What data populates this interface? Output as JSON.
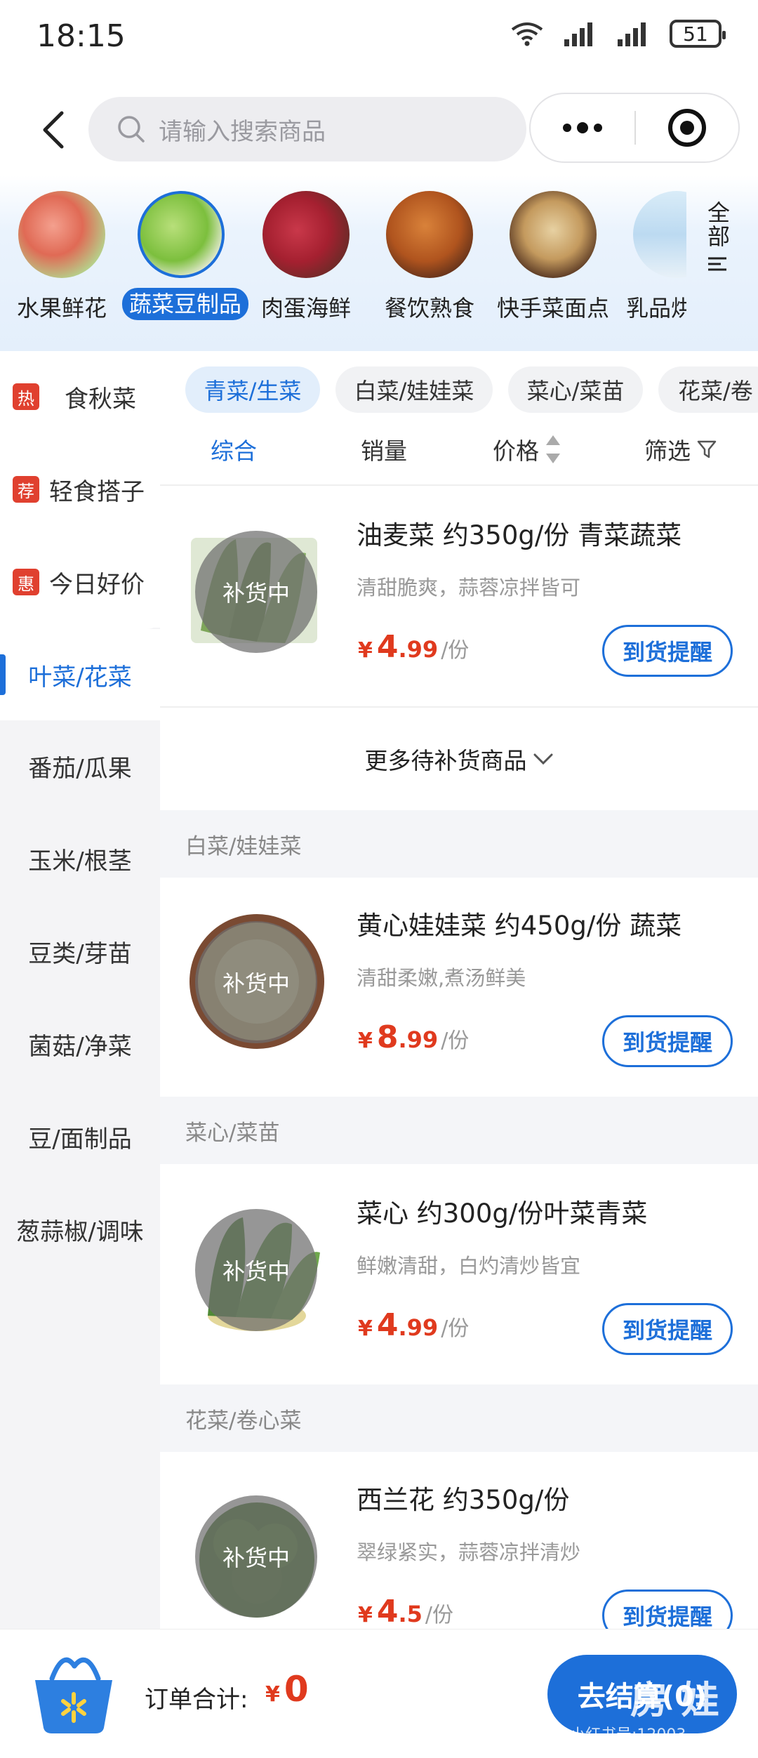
{
  "status_bar": {
    "time": "18:15",
    "battery": "51"
  },
  "header": {
    "search_placeholder": "请输入搜索商品"
  },
  "categories": [
    {
      "label": "水果鲜花",
      "active": false
    },
    {
      "label": "蔬菜豆制品",
      "active": true
    },
    {
      "label": "肉蛋海鲜",
      "active": false
    },
    {
      "label": "餐饮熟食",
      "active": false
    },
    {
      "label": "快手菜面点",
      "active": false
    },
    {
      "label": "乳品烘",
      "active": false
    }
  ],
  "category_all": "全部",
  "sidebar": {
    "items": [
      {
        "badge": "热",
        "label": "食秋菜"
      },
      {
        "badge": "荐",
        "label": "轻食搭子"
      },
      {
        "badge": "惠",
        "label": "今日好价"
      },
      {
        "label": "叶菜/花菜",
        "active": true
      },
      {
        "label": "番茄/瓜果"
      },
      {
        "label": "玉米/根茎"
      },
      {
        "label": "豆类/芽苗"
      },
      {
        "label": "菌菇/净菜"
      },
      {
        "label": "豆/面制品"
      },
      {
        "label": "葱蒜椒/调味"
      }
    ]
  },
  "subcategories": [
    {
      "label": "青菜/生菜",
      "active": true
    },
    {
      "label": "白菜/娃娃菜"
    },
    {
      "label": "菜心/菜苗"
    },
    {
      "label": "花菜/卷"
    }
  ],
  "sort": {
    "comprehensive": "综合",
    "sales": "销量",
    "price": "价格",
    "filter": "筛选"
  },
  "restock_label": "补货中",
  "more_restock": "更多待补货商品",
  "sections": {
    "s1": "白菜/娃娃菜",
    "s2": "菜心/菜苗",
    "s3": "花菜/卷心菜"
  },
  "products": [
    {
      "name": "油麦菜 约350g/份 青菜蔬菜",
      "desc": "清甜脆爽，蒜蓉凉拌皆可",
      "currency": "¥",
      "price_int": "4",
      "price_dec": ".99",
      "unit": "/份",
      "button": "到货提醒"
    },
    {
      "name": "黄心娃娃菜 约450g/份 蔬菜",
      "desc": "清甜柔嫩,煮汤鲜美",
      "currency": "¥",
      "price_int": "8",
      "price_dec": ".99",
      "unit": "/份",
      "button": "到货提醒"
    },
    {
      "name": "菜心 约300g/份叶菜青菜",
      "desc": "鲜嫩清甜，白灼清炒皆宜",
      "currency": "¥",
      "price_int": "4",
      "price_dec": ".99",
      "unit": "/份",
      "button": "到货提醒"
    },
    {
      "name": "西兰花 约350g/份",
      "desc": "翠绿紧实，蒜蓉凉拌清炒",
      "currency": "¥",
      "price_int": "4",
      "price_dec": ".5",
      "unit": "/份",
      "button": "到货提醒"
    }
  ],
  "bottom": {
    "order_total_label": "订单合计:",
    "currency": "¥",
    "order_total_value": "0",
    "checkout_label": "去结算(0)",
    "watermark_small": "小红书号:12003",
    "watermark_big": "房 娃"
  },
  "colors": {
    "accent": "#1d6fd9",
    "price": "#e03a1e",
    "badge": "#e0402f"
  }
}
